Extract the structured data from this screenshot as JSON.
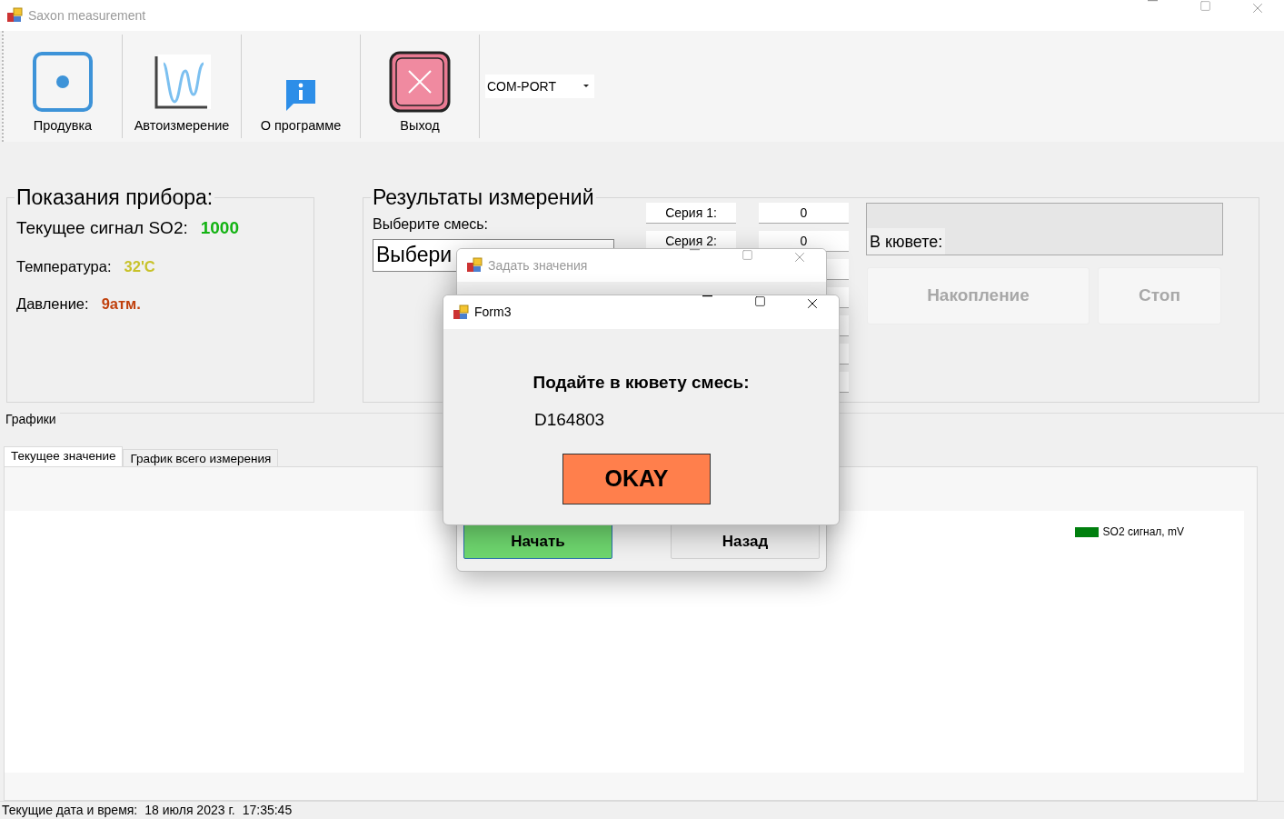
{
  "window": {
    "title": "Saxon measurement"
  },
  "toolbar": {
    "buttons": [
      {
        "kind": "purge",
        "label": "Продувка"
      },
      {
        "kind": "auto",
        "label": "Автоизмерение"
      },
      {
        "kind": "info",
        "label": "О программе"
      },
      {
        "kind": "exit",
        "label": "Выход"
      }
    ],
    "port_select": {
      "value": "COM-PORT"
    }
  },
  "readings": {
    "title": "Показания прибора:",
    "items": [
      {
        "label": "Текущее сигнал SO2:",
        "value": "1000",
        "color": "#13b313"
      },
      {
        "label": "Температура:",
        "value": "32'C",
        "color": "#c8c22a"
      },
      {
        "label": "Давление:",
        "value": "9атм.",
        "color": "#c0400c"
      }
    ]
  },
  "results": {
    "title": "Результаты измерений",
    "mix_label": "Выберите смесь:",
    "mix_value": "Выбери",
    "series": [
      {
        "label": "Серия 1:",
        "value": "0"
      },
      {
        "label": "Серия 2:",
        "value": "0"
      }
    ],
    "cuvette_label": "В кювете:",
    "buttons": [
      {
        "label": "Накопление",
        "disabled": true
      },
      {
        "label": "Стоп",
        "disabled": true
      }
    ]
  },
  "charts": {
    "title": "Графики",
    "tabs": [
      {
        "label": "Текущее значение",
        "selected": true
      },
      {
        "label": "График всего измерения",
        "selected": false
      }
    ],
    "legend": [
      {
        "label": "SO2 сигнал, mV",
        "color": "#007f0e"
      }
    ]
  },
  "status_bar": {
    "label": "Текущие дата и время:",
    "date": "18 июля 2023 г.",
    "time": "17:35:45"
  },
  "settings_dialog": {
    "title": "Задать значения",
    "active": false,
    "buttons": [
      {
        "label": "Начать",
        "kind": "primary"
      },
      {
        "label": "Назад",
        "kind": "plain"
      }
    ]
  },
  "message_dialog": {
    "title": "Form3",
    "active": true,
    "message": "Подайте в кювету смесь:",
    "code": "D164803",
    "button": "OKAY"
  }
}
